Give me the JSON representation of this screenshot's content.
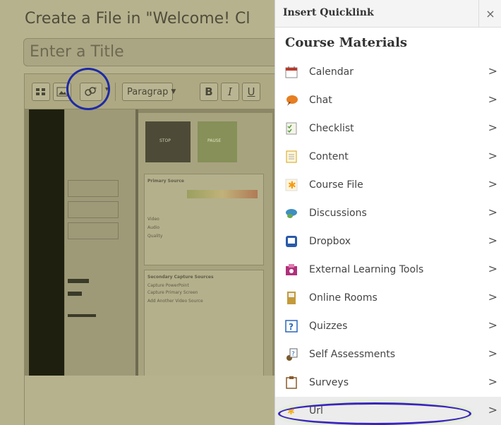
{
  "editor": {
    "page_title": "Create a File in \"Welcome! Cl",
    "title_placeholder": "Enter a Title",
    "toolbar": {
      "format_select": "Paragrap",
      "bold": "B",
      "italic": "I",
      "underline": "U"
    },
    "screenshot_text": {
      "stop": "STOP",
      "pause": "PAUSE",
      "primary_source": "Primary Source",
      "video": "Video",
      "audio": "Audio",
      "quality": "Quality",
      "secondary_sources": "Secondary Capture Sources",
      "capture_powerpoint": "Capture PowerPoint",
      "capture_primary_screen": "Capture Primary Screen",
      "add_video_source": "Add Another Video Source"
    }
  },
  "dialog": {
    "title": "Insert Quicklink",
    "close": "×",
    "section": "Course Materials",
    "items": [
      {
        "label": "Calendar",
        "icon": "calendar-icon",
        "color": "#c0392b"
      },
      {
        "label": "Chat",
        "icon": "chat-icon",
        "color": "#e67e22"
      },
      {
        "label": "Checklist",
        "icon": "checklist-icon",
        "color": "#5a9e3a"
      },
      {
        "label": "Content",
        "icon": "content-icon",
        "color": "#d4a017"
      },
      {
        "label": "Course File",
        "icon": "course-file-icon",
        "color": "#f39c12"
      },
      {
        "label": "Discussions",
        "icon": "discussions-icon",
        "color": "#3f8fbf"
      },
      {
        "label": "Dropbox",
        "icon": "dropbox-icon",
        "color": "#2a5aa8"
      },
      {
        "label": "External Learning Tools",
        "icon": "external-tools-icon",
        "color": "#b0307a"
      },
      {
        "label": "Online Rooms",
        "icon": "online-rooms-icon",
        "color": "#c49a3a"
      },
      {
        "label": "Quizzes",
        "icon": "quizzes-icon",
        "color": "#2a66b8"
      },
      {
        "label": "Self Assessments",
        "icon": "self-assessments-icon",
        "color": "#7a5a2a"
      },
      {
        "label": "Surveys",
        "icon": "surveys-icon",
        "color": "#8a5a2a"
      },
      {
        "label": "Url",
        "icon": "url-icon",
        "color": "#f2b01e"
      }
    ],
    "chevron": ">"
  }
}
